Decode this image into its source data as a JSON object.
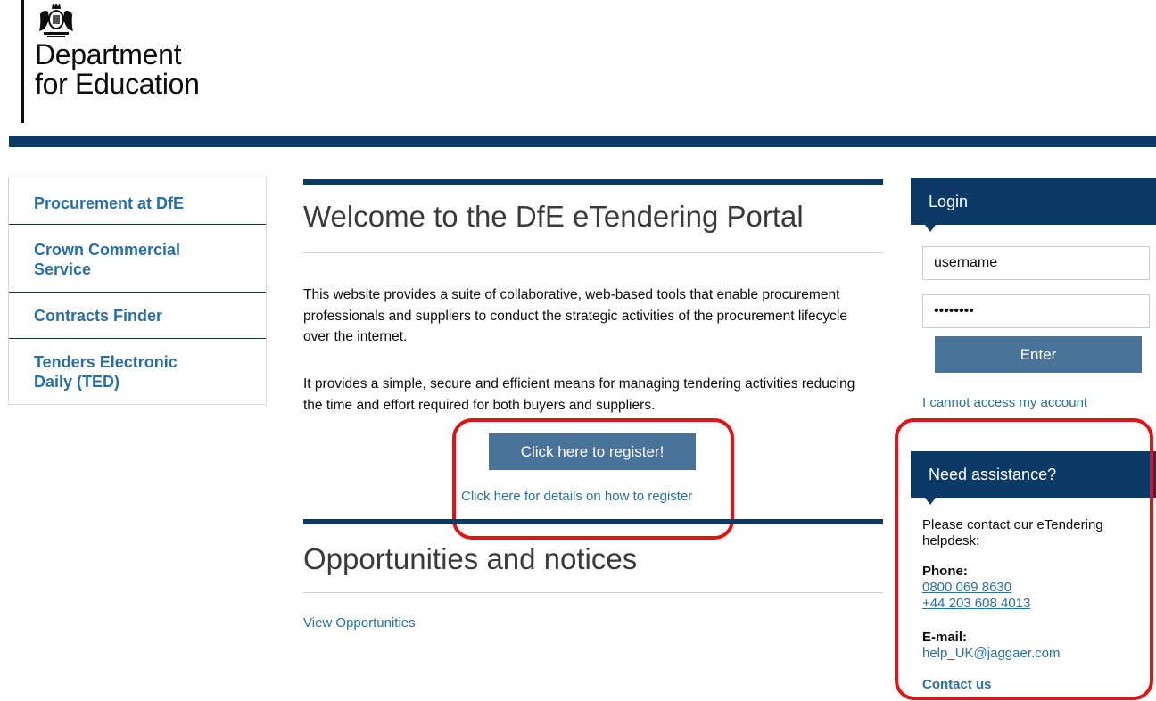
{
  "header": {
    "dept_line1": "Department",
    "dept_line2": "for Education",
    "crest_icon": "royal-coat-of-arms-icon"
  },
  "leftnav": {
    "items": [
      {
        "label_line1": "Procurement at DfE",
        "label_line2": ""
      },
      {
        "label_line1": "Crown Commercial",
        "label_line2": "Service"
      },
      {
        "label_line1": "Contracts Finder",
        "label_line2": ""
      },
      {
        "label_line1": "Tenders Electronic",
        "label_line2": "Daily (TED)"
      }
    ]
  },
  "main": {
    "title": "Welcome to the DfE eTendering Portal",
    "paragraph1": "This website provides a suite of collaborative, web-based tools that enable procurement professionals and suppliers to conduct the strategic activities of the procurement lifecycle over the internet.",
    "paragraph2": "It provides a simple, secure and efficient means for managing tendering activities reducing the time and effort required for both buyers and suppliers.",
    "register_button": "Click here to register!",
    "register_details_link": "Click here for details on how to register",
    "opportunities_title": "Opportunities and notices",
    "view_opportunities_link": "View Opportunities"
  },
  "login": {
    "title": "Login",
    "username_value": "username",
    "password_value": "••••••••",
    "enter_button": "Enter",
    "cannot_access_link": "I cannot access my account"
  },
  "assistance": {
    "title": "Need assistance?",
    "intro_line1": "Please contact our eTendering",
    "intro_line2": "helpdesk:",
    "phone_label": "Phone:",
    "phone1": "0800 069 8630",
    "phone2": "+44 203 608 4013",
    "email_label": "E-mail:",
    "email": "help_UK@jaggaer.com",
    "contact_link": "Contact us"
  },
  "colors": {
    "navy": "#0b3a66",
    "button_blue": "#4a7399",
    "link_blue": "#2b6ea4",
    "highlight_red": "#e01414"
  }
}
